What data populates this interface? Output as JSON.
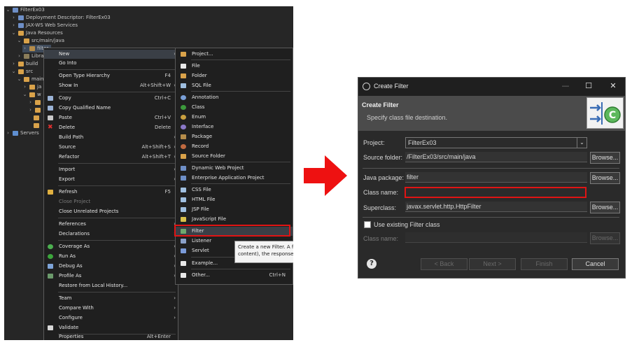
{
  "explorer": {
    "tree": [
      {
        "label": "FilterEx03"
      },
      {
        "label": "Deployment Descriptor: FilterEx03"
      },
      {
        "label": "JAX-WS Web Services"
      },
      {
        "label": "Java Resources"
      },
      {
        "label": "src/main/java"
      },
      {
        "label": "filter"
      },
      {
        "label": "Libra"
      },
      {
        "label": "build"
      },
      {
        "label": "src"
      },
      {
        "label": "main"
      },
      {
        "label": "ja"
      },
      {
        "label": "w"
      },
      {
        "label": "Servers"
      }
    ]
  },
  "context_menu": {
    "items": [
      {
        "label": "New",
        "shortcut": "",
        "arrow": "›"
      },
      {
        "label": "Go Into",
        "shortcut": "",
        "arrow": ""
      },
      {
        "label": "Open Type Hierarchy",
        "shortcut": "F4",
        "arrow": ""
      },
      {
        "label": "Show In",
        "shortcut": "Alt+Shift+W",
        "arrow": "›"
      },
      {
        "label": "Copy",
        "shortcut": "Ctrl+C",
        "arrow": ""
      },
      {
        "label": "Copy Qualified Name",
        "shortcut": "",
        "arrow": ""
      },
      {
        "label": "Paste",
        "shortcut": "Ctrl+V",
        "arrow": ""
      },
      {
        "label": "Delete",
        "shortcut": "Delete",
        "arrow": ""
      },
      {
        "label": "Build Path",
        "shortcut": "",
        "arrow": "›"
      },
      {
        "label": "Source",
        "shortcut": "Alt+Shift+S",
        "arrow": "›"
      },
      {
        "label": "Refactor",
        "shortcut": "Alt+Shift+T",
        "arrow": "›"
      },
      {
        "label": "Import",
        "shortcut": "",
        "arrow": "›"
      },
      {
        "label": "Export",
        "shortcut": "",
        "arrow": "›"
      },
      {
        "label": "Refresh",
        "shortcut": "F5",
        "arrow": ""
      },
      {
        "label": "Close Project",
        "shortcut": "",
        "arrow": ""
      },
      {
        "label": "Close Unrelated Projects",
        "shortcut": "",
        "arrow": ""
      },
      {
        "label": "References",
        "shortcut": "",
        "arrow": "›"
      },
      {
        "label": "Declarations",
        "shortcut": "",
        "arrow": "›"
      },
      {
        "label": "Coverage As",
        "shortcut": "",
        "arrow": "›"
      },
      {
        "label": "Run As",
        "shortcut": "",
        "arrow": "›"
      },
      {
        "label": "Debug As",
        "shortcut": "",
        "arrow": "›"
      },
      {
        "label": "Profile As",
        "shortcut": "",
        "arrow": "›"
      },
      {
        "label": "Restore from Local History...",
        "shortcut": "",
        "arrow": ""
      },
      {
        "label": "Team",
        "shortcut": "",
        "arrow": "›"
      },
      {
        "label": "Compare With",
        "shortcut": "",
        "arrow": "›"
      },
      {
        "label": "Configure",
        "shortcut": "",
        "arrow": "›"
      },
      {
        "label": "Validate",
        "shortcut": "",
        "arrow": ""
      },
      {
        "label": "Properties",
        "shortcut": "Alt+Enter",
        "arrow": ""
      }
    ]
  },
  "new_submenu": {
    "items": [
      {
        "label": "Project...",
        "shortcut": ""
      },
      {
        "label": "File",
        "shortcut": ""
      },
      {
        "label": "Folder",
        "shortcut": ""
      },
      {
        "label": "SQL File",
        "shortcut": ""
      },
      {
        "label": "Annotation",
        "shortcut": ""
      },
      {
        "label": "Class",
        "shortcut": ""
      },
      {
        "label": "Enum",
        "shortcut": ""
      },
      {
        "label": "Interface",
        "shortcut": ""
      },
      {
        "label": "Package",
        "shortcut": ""
      },
      {
        "label": "Record",
        "shortcut": ""
      },
      {
        "label": "Source Folder",
        "shortcut": ""
      },
      {
        "label": "Dynamic Web Project",
        "shortcut": ""
      },
      {
        "label": "Enterprise Application Project",
        "shortcut": ""
      },
      {
        "label": "CSS File",
        "shortcut": ""
      },
      {
        "label": "HTML File",
        "shortcut": ""
      },
      {
        "label": "JSP File",
        "shortcut": ""
      },
      {
        "label": "JavaScript File",
        "shortcut": ""
      },
      {
        "label": "Filter",
        "shortcut": ""
      },
      {
        "label": "Listener",
        "shortcut": ""
      },
      {
        "label": "Servlet",
        "shortcut": ""
      },
      {
        "label": "Example...",
        "shortcut": ""
      },
      {
        "label": "Other...",
        "shortcut": "Ctrl+N"
      }
    ]
  },
  "tooltip": {
    "line1": "Create a new Filter. A fil",
    "line2": "content), the response fr"
  },
  "dialog": {
    "title": "Create Filter",
    "header_title": "Create Filter",
    "header_subtitle": "Specify class file destination.",
    "project_label": "Project:",
    "project_value": "FilterEx03",
    "source_folder_label": "Source folder:",
    "source_folder_value": "/FilterEx03/src/main/java",
    "java_package_label": "Java package:",
    "java_package_value": "filter",
    "class_name_label": "Class name:",
    "class_name_value": "",
    "superclass_label": "Superclass:",
    "superclass_value": "javax.servlet.http.HttpFilter",
    "browse_label": "Browse...",
    "use_existing_label": "Use existing Filter class",
    "existing_class_label": "Class name:",
    "back_label": "< Back",
    "next_label": "Next >",
    "finish_label": "Finish",
    "cancel_label": "Cancel",
    "minimize": "—",
    "maximize": "☐",
    "close": "✕"
  },
  "colors": {
    "highlight_red": "#e01414",
    "arrow_red": "#ee1111"
  }
}
